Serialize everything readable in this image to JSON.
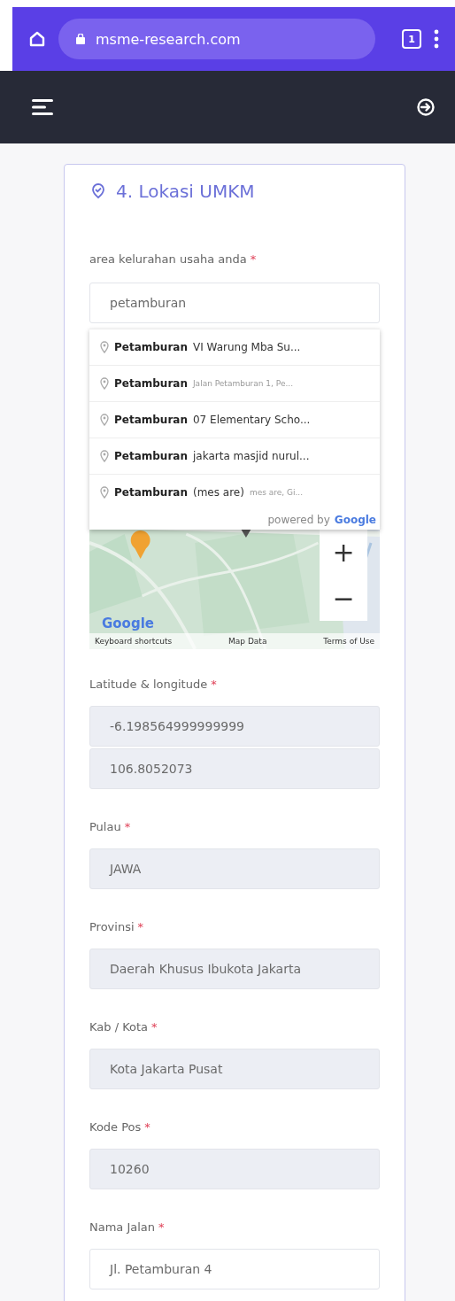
{
  "browser": {
    "url": "msme-research.com",
    "tab_count": "1"
  },
  "section": {
    "title": "4. Lokasi UMKM"
  },
  "search": {
    "label": "area kelurahan usaha anda",
    "mark": "*",
    "value": "petamburan",
    "suggestions": [
      {
        "main": "Petamburan",
        "secondary": "VI Warung Mba Su..."
      },
      {
        "main": "Petamburan",
        "detail": "Jalan Petamburan 1, Pe..."
      },
      {
        "main": "Petamburan",
        "secondary": "07 Elementary Scho..."
      },
      {
        "main": "Petamburan",
        "secondary": "jakarta masjid nurul..."
      },
      {
        "main": "Petamburan",
        "secondary": "(mes are)",
        "detail": "mes are, Gi..."
      }
    ],
    "powered_by": "powered by",
    "powered_brand": "Google"
  },
  "map": {
    "zoom_in": "+",
    "zoom_out": "−",
    "logo": "Google",
    "links": [
      "Keyboard shortcuts",
      "Map Data",
      "Terms of Use"
    ]
  },
  "fields": [
    {
      "label": "Latitude & longitude",
      "mark": "*",
      "values": [
        "-6.198564999999999",
        "106.8052073"
      ],
      "readonly": true
    },
    {
      "label": "Pulau",
      "mark": "*",
      "values": [
        "JAWA"
      ],
      "readonly": true
    },
    {
      "label": "Provinsi",
      "mark": "*",
      "values": [
        "Daerah Khusus Ibukota Jakarta"
      ],
      "readonly": true
    },
    {
      "label": "Kab / Kota",
      "mark": "*",
      "values": [
        "Kota Jakarta Pusat"
      ],
      "readonly": true
    },
    {
      "label": "Kode Pos",
      "mark": "*",
      "values": [
        "10260"
      ],
      "readonly": true
    },
    {
      "label": "Nama Jalan",
      "mark": "*",
      "values": [
        "Jl. Petamburan 4"
      ],
      "readonly": false
    }
  ]
}
